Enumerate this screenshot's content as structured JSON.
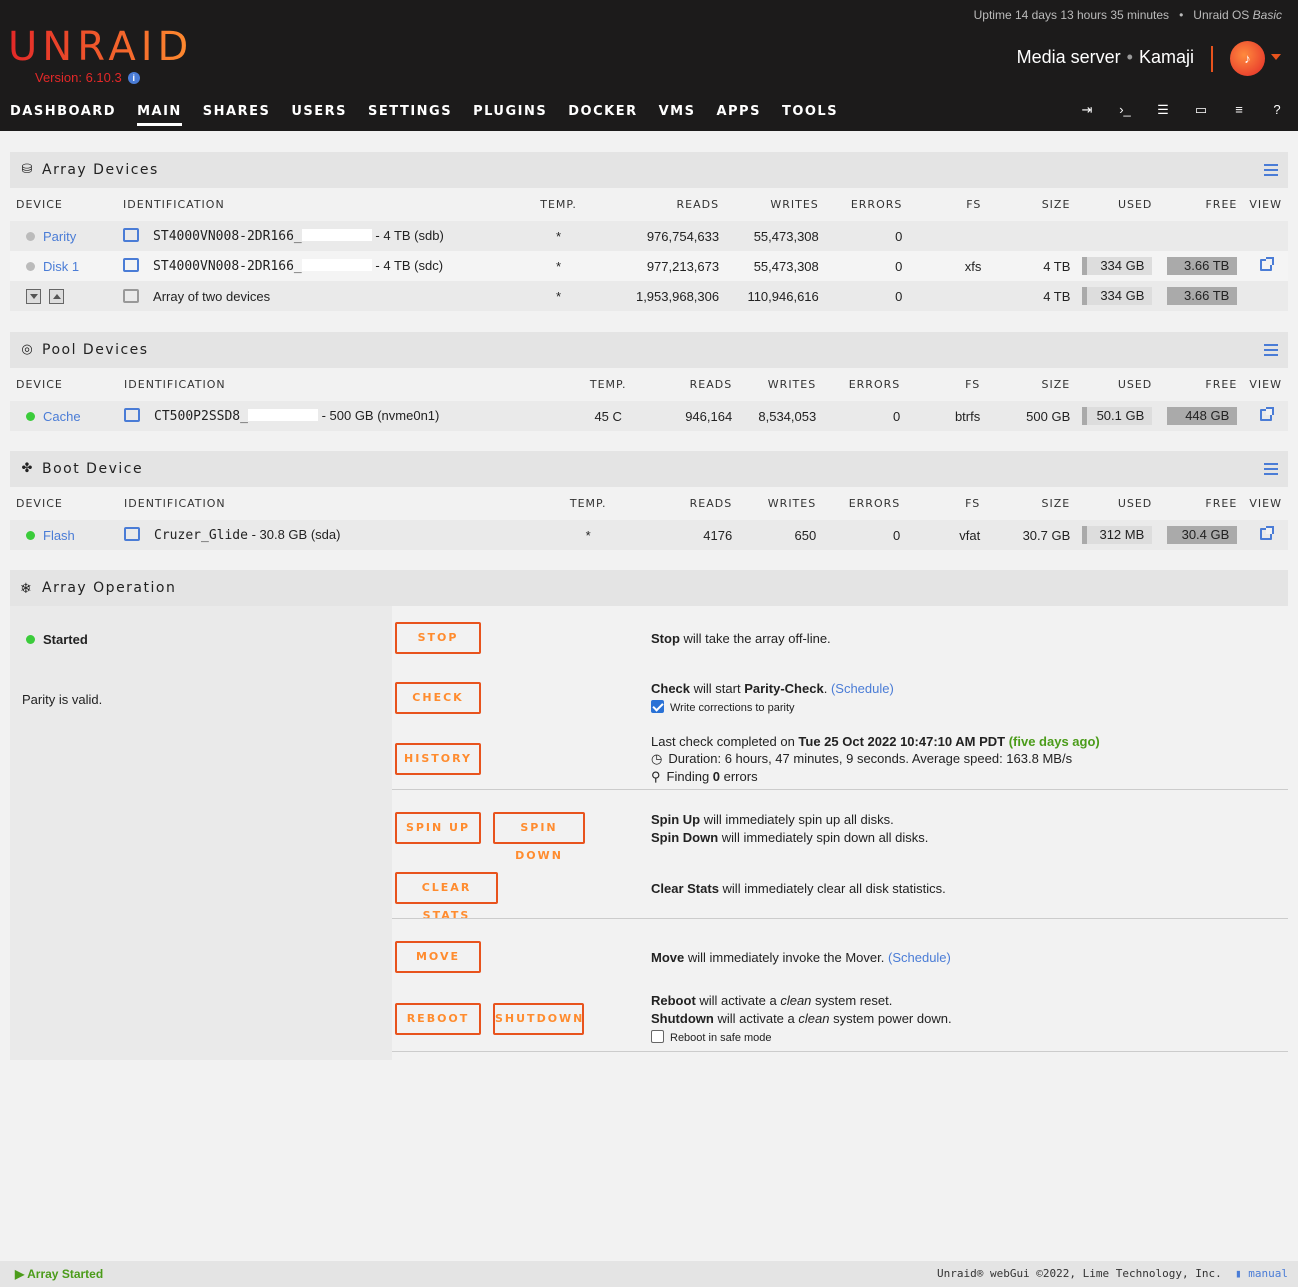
{
  "header": {
    "logo": "UNRAID",
    "version": "Version: 6.10.3",
    "uptime_prefix": "Uptime 14 days 13 hours 35 minutes",
    "os_name": "Unraid OS",
    "os_edition": "Basic",
    "server_description": "Media server",
    "server_name": "Kamaji"
  },
  "nav": {
    "tabs": [
      "DASHBOARD",
      "MAIN",
      "SHARES",
      "USERS",
      "SETTINGS",
      "PLUGINS",
      "DOCKER",
      "VMS",
      "APPS",
      "TOOLS"
    ],
    "active": "MAIN",
    "icons": [
      "logout-icon",
      "terminal-icon",
      "feedback-icon",
      "info-screen-icon",
      "log-icon",
      "help-icon"
    ]
  },
  "columns": {
    "device": "DEVICE",
    "identification": "IDENTIFICATION",
    "temp": "TEMP.",
    "reads": "READS",
    "writes": "WRITES",
    "errors": "ERRORS",
    "fs": "FS",
    "size": "SIZE",
    "used": "USED",
    "free": "FREE",
    "view": "VIEW"
  },
  "array": {
    "title": "Array Devices",
    "rows": [
      {
        "device": "Parity",
        "status": "standby",
        "id": "ST4000VN008-2DR166_",
        "id_suffix": "- 4 TB (sdb)",
        "temp": "*",
        "reads": "976,754,633",
        "writes": "55,473,308",
        "errors": "0",
        "fs": "",
        "size": "",
        "used": "",
        "free": ""
      },
      {
        "device": "Disk 1",
        "status": "standby",
        "id": "ST4000VN008-2DR166_",
        "id_suffix": "- 4 TB (sdc)",
        "temp": "*",
        "reads": "977,213,673",
        "writes": "55,473,308",
        "errors": "0",
        "fs": "xfs",
        "size": "4 TB",
        "used": "334 GB",
        "free": "3.66 TB"
      },
      {
        "device": "",
        "status": "",
        "id": "Array of two devices",
        "id_suffix": "",
        "temp": "*",
        "reads": "1,953,968,306",
        "writes": "110,946,616",
        "errors": "0",
        "fs": "",
        "size": "4 TB",
        "used": "334 GB",
        "free": "3.66 TB"
      }
    ]
  },
  "pool": {
    "title": "Pool Devices",
    "rows": [
      {
        "device": "Cache",
        "status": "active",
        "id": "CT500P2SSD8_",
        "id_suffix": "- 500 GB (nvme0n1)",
        "temp": "45 C",
        "reads": "946,164",
        "writes": "8,534,053",
        "errors": "0",
        "fs": "btrfs",
        "size": "500 GB",
        "used": "50.1 GB",
        "free": "448 GB"
      }
    ]
  },
  "boot": {
    "title": "Boot Device",
    "rows": [
      {
        "device": "Flash",
        "status": "active",
        "id": "Cruzer_Glide",
        "id_suffix": "- 30.8 GB (sda)",
        "temp": "*",
        "reads": "4176",
        "writes": "650",
        "errors": "0",
        "fs": "vfat",
        "size": "30.7 GB",
        "used": "312 MB",
        "free": "30.4 GB"
      }
    ]
  },
  "operation": {
    "title": "Array Operation",
    "status": "Started",
    "parity_note": "Parity is valid.",
    "buttons": {
      "stop": "STOP",
      "check": "CHECK",
      "history": "HISTORY",
      "spin_up": "SPIN UP",
      "spin_down": "SPIN DOWN",
      "clear_stats": "CLEAR STATS",
      "move": "MOVE",
      "reboot": "REBOOT",
      "shutdown": "SHUTDOWN"
    },
    "stop_b": "Stop",
    "stop_text": " will take the array off-line.",
    "check_b": "Check",
    "check_text": " will start ",
    "check_b2": "Parity-Check",
    "check_dot": ".",
    "schedule": "(Schedule)",
    "write_corrections": "Write corrections to parity",
    "last_check": "Last check completed on ",
    "last_check_date": "Tue 25 Oct 2022 10:47:10 AM PDT",
    "last_check_ago": "(five days ago)",
    "duration": "Duration: 6 hours, 47 minutes, 9 seconds. Average speed: 163.8 MB/s",
    "finding": "Finding ",
    "finding_count": "0",
    "finding_suffix": " errors",
    "spinup_b": "Spin Up",
    "spinup_text": " will immediately spin up all disks.",
    "spindown_b": "Spin Down",
    "spindown_text": " will immediately spin down all disks.",
    "clear_b": "Clear Stats",
    "clear_text": " will immediately clear all disk statistics.",
    "move_b": "Move",
    "move_text": " will immediately invoke the Mover.",
    "reboot_b": "Reboot",
    "reboot_text1": " will activate a ",
    "clean": "clean",
    "reboot_text2": " system reset.",
    "shutdown_b": "Shutdown",
    "shutdown_text2": " system power down.",
    "safe_mode": "Reboot in safe mode"
  },
  "footer": {
    "status": "Array Started",
    "copyright": "Unraid® webGui ©2022, Lime Technology, Inc.",
    "manual": "manual"
  }
}
